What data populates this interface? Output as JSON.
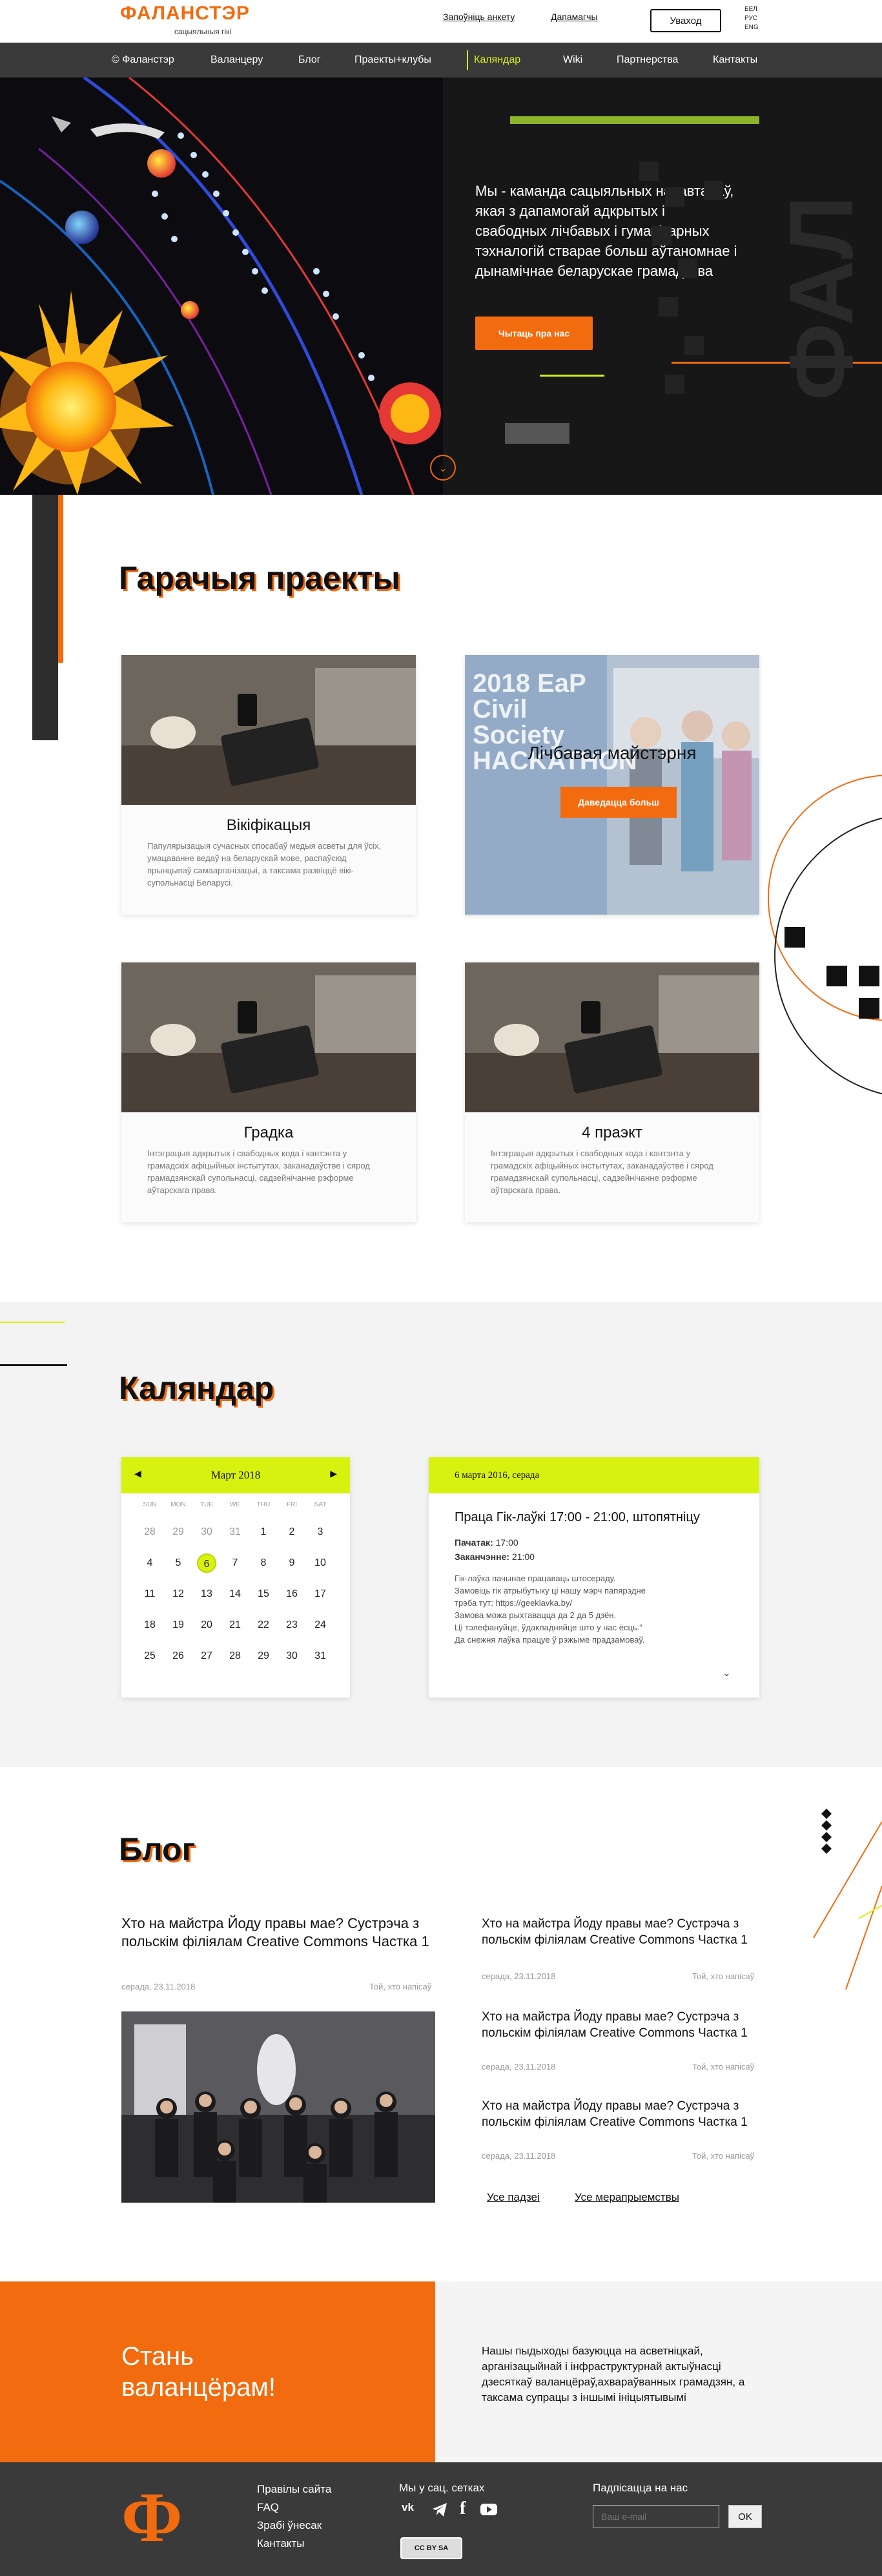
{
  "header": {
    "logo_title": "ФАЛАНСТЭР",
    "logo_sub": "сацыяльныя гікі",
    "fill_form": "Запоўніць анкету",
    "helpers": "Дапамагчы",
    "login": "Уваход",
    "langs": [
      "БЕЛ",
      "РУС",
      "ENG"
    ]
  },
  "nav": {
    "items": [
      "© Фаланстэр",
      "Валанцеру",
      "Блог",
      "Праекты+клубы",
      "Каляндар",
      "Wiki",
      "Партнерства",
      "Кантакты"
    ],
    "active_index": 4
  },
  "hero": {
    "text": "Мы - каманда сацыяльных нававтараў, якая з дапамогай адкрытых і свабодных лічбавых і гуманітарных тэхналогій стварае больш аўтаномнае і дынамічнае беларускае грамадства",
    "button": "Чытаць пра нас"
  },
  "projects": {
    "title": "Гарачыя праекты",
    "cards": [
      {
        "title": "Вікіфікацыя",
        "desc": "Папулярызацыя сучасных спосабаў медыя асветы для ўсіх, умацаванне ведаў на беларускай мове, распаўсюд прынцыпаў самаарганізацыі, а таксама развіццё вікі-супольнасці Беларусі."
      },
      {
        "title": "Лічбавая майстэрня",
        "button": "Даведацца больш",
        "overlay_text": "2018 EaP Civil Society HACKATHON"
      },
      {
        "title": "Градка",
        "desc": "Інтэграцыя адкрытых і свабодных кода і кантэнта у грамадскіх афіцыйных інстытутах, заканадаўстве і сярод грамадзянскай супольнасці, садзейнічанне рэформе аўтарскага права."
      },
      {
        "title": "4 праэкт",
        "desc": "Інтэграцыя адкрытых і свабодных кода і кантэнта у грамадскіх афіцыйных інстытутах, заканадаўстве і сярод грамадзянскай супольнасці, садзейнічанне рэформе аўтарскага права."
      }
    ]
  },
  "calendar": {
    "title": "Каляндар",
    "month": "Март 2018",
    "dow": [
      "SUN",
      "MON",
      "TUE",
      "WE",
      "THU",
      "FRI",
      "SAT"
    ],
    "weeks": [
      [
        "28",
        "29",
        "30",
        "31",
        "1",
        "2",
        "3"
      ],
      [
        "4",
        "5",
        "6",
        "7",
        "8",
        "9",
        "10"
      ],
      [
        "11",
        "12",
        "13",
        "14",
        "15",
        "16",
        "17"
      ],
      [
        "18",
        "19",
        "20",
        "21",
        "22",
        "23",
        "24"
      ],
      [
        "25",
        "26",
        "27",
        "28",
        "29",
        "30",
        "31"
      ]
    ],
    "selected": "6",
    "event": {
      "date": "6 марта 2016, серада",
      "title": "Праца Гік-лаўкі 17:00 - 21:00, штопятніцу",
      "start_label": "Пачатак:",
      "start_time": "17:00",
      "end_label": "Заканчэнне:",
      "end_time": "21:00",
      "desc": [
        "Гік-лаўка пачынае працаваць штосераду.",
        "Замовіць гік атрыбутыку ці нашу мэрч папярэдне",
        "трэба тут: https://geeklavka.by/",
        "Замова можа рыхтавацца да 2 да 5 дзён.",
        "Ці тэлефануйце, ўдакладняйце што у нас ёсць.\"",
        "Да снежня лаўка працуе ў рэжыме прадзамоваў."
      ]
    }
  },
  "blog": {
    "title": "Блог",
    "main_post": {
      "title": "Хто на майстра Йоду правы мае?  Сустрэча з польскім філіялам Creative Commons Частка 1",
      "date": "серада, 23.11.2018",
      "author": "Той, хто напісаў"
    },
    "posts": [
      {
        "title": "Хто на майстра Йоду правы мае?  Сустрэча з польскім філіялам  Creative Commons Частка 1",
        "date": "серада, 23.11.2018",
        "author": "Той, хто напісаў"
      },
      {
        "title": "Хто на майстра Йоду правы мае?  Сустрэча з польскім філіялам Creative Commons Частка 1",
        "date": "серада, 23.11.2018",
        "author": "Той, хто напісаў"
      },
      {
        "title": "Хто на майстра Йоду правы мае? Сустрэча з польскім філіялам Creative Commons Частка 1",
        "date": "серада, 23.11.2018",
        "author": "Той, хто напісаў"
      }
    ],
    "all_posts": "Усе падзеі",
    "all_events": "Усе мерапрыемствы"
  },
  "volunteer": {
    "title": "Стань валанцёрам!",
    "text": "Нашы пыдыходы базуюцца на асветніцкай, арганізацыйнай і інфраструктурнай актыўнасці дзесяткаў валанцёраў,ахвараўванных грамадзян, а таксама супрацы з іншымі ініцыятывымі"
  },
  "footer": {
    "links": [
      "Правілы сайта",
      "FAQ",
      "Зрабі ўнесак",
      "Кантакты"
    ],
    "social_title": "Мы у сац. сетках",
    "subscribe_title": "Падпісацца на нас",
    "email_placeholder": "Ваш e-mail",
    "ok": "OK",
    "logo_letter": "Ф",
    "license": "CC BY SA"
  },
  "colors": {
    "orange": "#f26b0f",
    "lime": "#d7f20e",
    "dark": "#3a3a3a"
  }
}
